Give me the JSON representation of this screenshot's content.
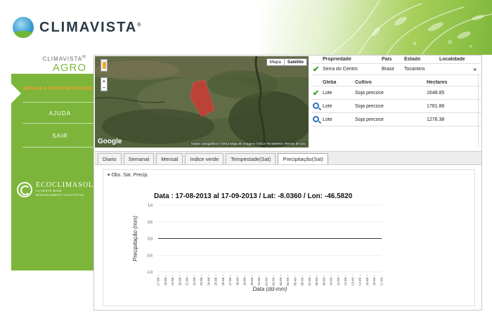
{
  "header": {
    "brand": "CLIMAVISTA",
    "brand_mark": "®"
  },
  "sidebar": {
    "brand_small": "CLIMAVISTA",
    "brand_small_mark": "®",
    "brand_agro": "AGRO",
    "items": [
      {
        "label": "MINHAS PROPRIEDADES",
        "active": true
      },
      {
        "label": "AJUDA",
        "active": false
      },
      {
        "label": "SAIR",
        "active": false
      }
    ],
    "partner": {
      "name": "ECOCLIMASOL",
      "tagline_1": "CLIMATE RISK",
      "tagline_2": "MANAGEMENT SOLUTIONS"
    }
  },
  "map": {
    "type_buttons": [
      "Mapa",
      "Satélite"
    ],
    "google_label": "Google",
    "attribution": "Dados cartográficos ©2013 MapLink Imagens ©2013 TerraMetrics   Termos de Uso",
    "zoom_in": "+",
    "zoom_out": "−"
  },
  "property": {
    "headers": [
      "Propriedade",
      "País",
      "Estado",
      "Localidade"
    ],
    "row": {
      "name": "Serra do Centro",
      "country": "Brasil",
      "state": "Tocantins",
      "locality": "",
      "close": "×"
    }
  },
  "plots": {
    "headers": [
      "Gleba",
      "Cultivo",
      "Hectares"
    ],
    "rows": [
      {
        "icon": "check-icon",
        "gleba": "Lote",
        "cultivo": "Soja precoce",
        "hectares": "1648.85"
      },
      {
        "icon": "search-icon",
        "gleba": "Lote",
        "cultivo": "Soja precoce",
        "hectares": "1781.86"
      },
      {
        "icon": "search-icon",
        "gleba": "Lote",
        "cultivo": "Soja precoce",
        "hectares": "1276.38"
      }
    ]
  },
  "tabs": [
    "Diario",
    "Semanal",
    "Mensal",
    "Indice verde",
    "Tempestade(Sat)",
    "Precipitação(Sat)"
  ],
  "active_tab": 5,
  "chart_panel": {
    "section_label": "Obs. Sat. Precip."
  },
  "chart_data": {
    "type": "line",
    "title": "Data : 17-08-2013 al 17-09-2013 / Lat: -8.0360 / Lon: -46.5820",
    "xlabel": "Data (dd-mm)",
    "ylabel": "Precipitação (mm)",
    "ylim": [
      -1.0,
      1.0
    ],
    "yticks": [
      "1,0",
      "0,5",
      "0,0",
      "-0,5",
      "-1,0"
    ],
    "categories": [
      "17-08",
      "18-08",
      "19-08",
      "20-08",
      "21-08",
      "22-08",
      "23-08",
      "24-08",
      "25-08",
      "26-08",
      "27-08",
      "28-08",
      "29-08",
      "30-08",
      "31-08",
      "01-09",
      "02-09",
      "03-09",
      "04-09",
      "05-09",
      "06-09",
      "07-09",
      "08-09",
      "09-09",
      "10-09",
      "11-09",
      "12-09",
      "13-09",
      "14-09",
      "15-09",
      "16-09",
      "17-09"
    ],
    "series": [
      {
        "values": [
          0,
          0,
          0,
          0,
          0,
          0,
          0,
          0,
          0,
          0,
          0,
          0,
          0,
          0,
          0,
          0,
          0,
          0,
          0,
          0,
          0,
          0,
          0,
          0,
          0,
          0,
          0,
          0,
          0,
          0,
          0,
          0
        ]
      }
    ],
    "grid": true,
    "colors": {
      "line": "#333333",
      "grid": "#dddddd"
    }
  },
  "colors": {
    "accent_green": "#7cb53a",
    "active_menu": "#ff9e2c",
    "field_polygon": "#e03030"
  }
}
